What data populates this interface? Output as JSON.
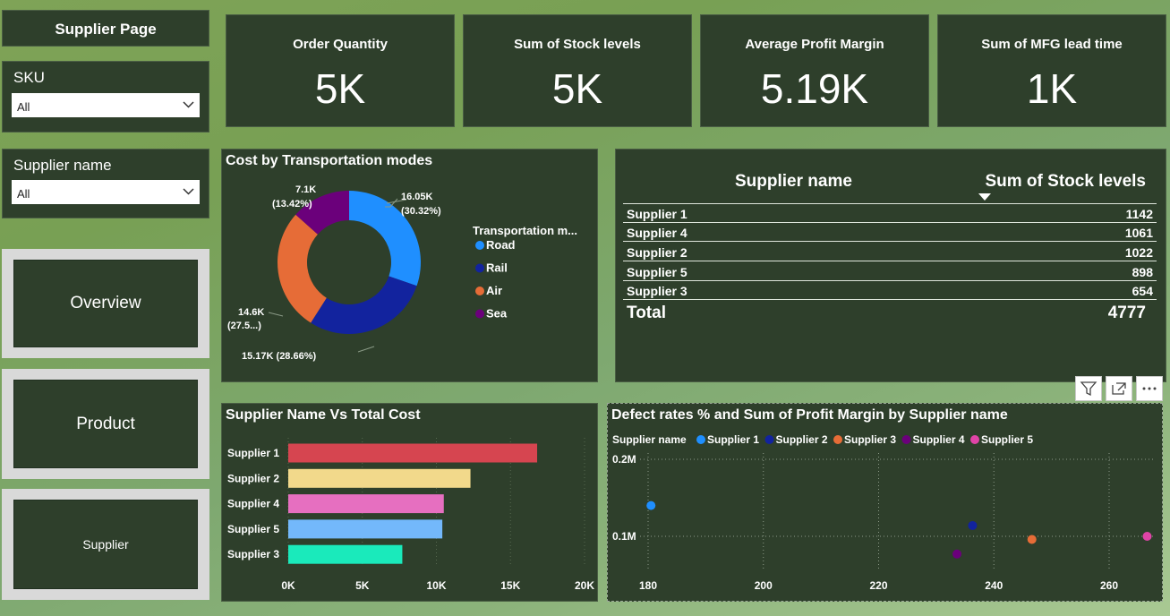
{
  "page_title": "Supplier Page",
  "slicers": {
    "sku": {
      "label": "SKU",
      "value": "All"
    },
    "supplier": {
      "label": "Supplier name",
      "value": "All"
    }
  },
  "nav": {
    "overview": "Overview",
    "product": "Product",
    "supplier": "Supplier"
  },
  "cards": [
    {
      "title": "Order Quantity",
      "value": "5K"
    },
    {
      "title": "Sum of Stock levels",
      "value": "5K"
    },
    {
      "title": "Average Profit Margin",
      "value": "5.19K"
    },
    {
      "title": "Sum of MFG lead time",
      "value": "1K"
    }
  ],
  "donut": {
    "title": "Cost by Transportation modes",
    "legend_title": "Transportation m...",
    "labels": {
      "road": [
        "16.05K",
        "(30.32%)"
      ],
      "rail": [
        "15.17K (28.66%)"
      ],
      "air": [
        "14.6K",
        "(27.5...)"
      ],
      "sea": [
        "7.1K",
        "(13.42%)"
      ]
    }
  },
  "table": {
    "col1": "Supplier name",
    "col2": "Sum of Stock levels",
    "rows": [
      {
        "name": "Supplier 1",
        "value": "1142"
      },
      {
        "name": "Supplier 4",
        "value": "1061"
      },
      {
        "name": "Supplier 2",
        "value": "1022"
      },
      {
        "name": "Supplier 5",
        "value": "898"
      },
      {
        "name": "Supplier 3",
        "value": "654"
      }
    ],
    "total_label": "Total",
    "total_value": "4777"
  },
  "bar_title": "Supplier Name Vs Total Cost",
  "scatter_title": "Defect rates % and Sum of Profit Margin by Supplier name",
  "scatter_legend_title": "Supplier name",
  "chart_data": [
    {
      "type": "pie",
      "title": "Cost by Transportation modes",
      "legend_title": "Transportation m...",
      "categories": [
        "Road",
        "Rail",
        "Air",
        "Sea"
      ],
      "values": [
        16.05,
        15.17,
        14.6,
        7.1
      ],
      "unit": "K",
      "percentages": [
        30.32,
        28.66,
        27.5,
        13.42
      ],
      "colors": [
        "#1f8fff",
        "#12239e",
        "#e66c37",
        "#6b007b"
      ]
    },
    {
      "type": "bar",
      "title": "Supplier Name Vs Total Cost",
      "categories": [
        "Supplier 1",
        "Supplier 2",
        "Supplier 4",
        "Supplier 5",
        "Supplier 3"
      ],
      "values": [
        16800,
        12300,
        10500,
        10400,
        7700
      ],
      "xlim": [
        0,
        20000
      ],
      "ticks": [
        "0K",
        "5K",
        "10K",
        "15K",
        "20K"
      ],
      "colors": [
        "#d64550",
        "#f2d98b",
        "#e66fc0",
        "#73b8fb",
        "#1aeabb"
      ]
    },
    {
      "type": "scatter",
      "title": "Defect rates % and Sum of Profit Margin by Supplier name",
      "legend_title": "Supplier name",
      "series": [
        {
          "name": "Supplier 1",
          "color": "#1f8fff",
          "x": 180.5,
          "y": 140000
        },
        {
          "name": "Supplier 2",
          "color": "#12239e",
          "x": 236.3,
          "y": 114000
        },
        {
          "name": "Supplier 3",
          "color": "#e66c37",
          "x": 246.6,
          "y": 96000
        },
        {
          "name": "Supplier 4",
          "color": "#6b007b",
          "x": 233.6,
          "y": 77000
        },
        {
          "name": "Supplier 5",
          "color": "#e044a7",
          "x": 266.6,
          "y": 100000
        }
      ],
      "xlim": [
        180,
        270
      ],
      "ylim": [
        60000,
        200000
      ],
      "xticks": [
        "180",
        "200",
        "220",
        "240",
        "260"
      ],
      "yticks": [
        "0.1M",
        "0.2M"
      ]
    }
  ]
}
